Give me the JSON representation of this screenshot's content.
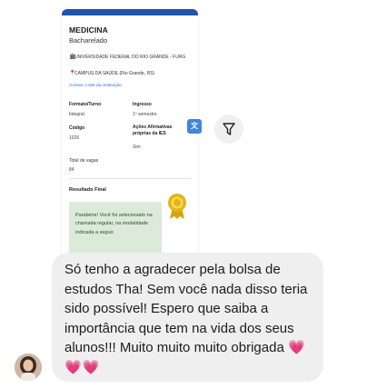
{
  "course_card": {
    "course_name": "MEDICINA",
    "degree": "Bacharelado",
    "institution": "UNIVERSIDADE FEDERAL DO RIO GRANDE - FURG",
    "campus": "CAMPUS DA SAÚDE (Rio Grande, RS)",
    "institution_link": "Acesse o site da instituição",
    "fields": {
      "format_label": "Formato/Turno",
      "format_value": "Integral",
      "entry_label": "Ingresso",
      "entry_value": "1º semestre",
      "code_label": "Código",
      "code_value": "1026",
      "affirmative_label": "Ações Afirmativas próprias da IES",
      "affirmative_value": "Sim",
      "vacancies_label": "Total de vagas",
      "vacancies_value": "84"
    },
    "result_title": "Resultado Final",
    "result_message": "Parabéns! Você foi selecionado na chamada regular, na modalidade indicada a seguir."
  },
  "actions": {
    "translate_icon": "translate-icon",
    "filter_icon": "filter-icon"
  },
  "message": {
    "text": "Só tenho a agradecer pela bolsa de estudos Tha! Sem você nada disso teria sido possível! Espero que saiba a importância que tem na vida dos seus alunos!!! Muito muito muito obrigada",
    "emoji": "💗💗💗"
  },
  "colors": {
    "header_bar": "#1f54a8",
    "link": "#2f6fd6",
    "result_box": "#dcebd9",
    "bubble": "#efefef",
    "hearts": "#e3209b"
  }
}
